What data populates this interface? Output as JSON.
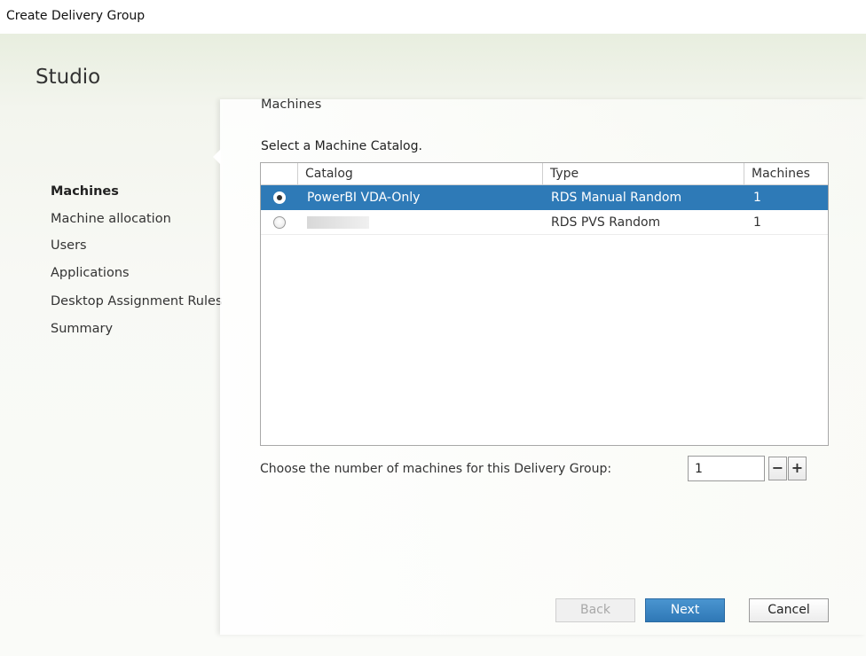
{
  "window": {
    "title": "Create Delivery Group"
  },
  "sidebar": {
    "brand": "Studio",
    "items": [
      {
        "label": "Machines",
        "active": true
      },
      {
        "label": "Machine allocation",
        "active": false
      },
      {
        "label": "Users",
        "active": false
      },
      {
        "label": "Applications",
        "active": false
      },
      {
        "label": "Desktop Assignment Rules",
        "active": false
      },
      {
        "label": "Summary",
        "active": false
      }
    ]
  },
  "main": {
    "title": "Machines",
    "subtitle": "Select a Machine Catalog.",
    "table": {
      "columns": [
        "Catalog",
        "Type",
        "Machines"
      ],
      "rows": [
        {
          "catalog": "PowerBI VDA-Only",
          "type": "RDS Manual Random",
          "machines": "1",
          "selected": true
        },
        {
          "catalog": "",
          "type": "RDS PVS Random",
          "machines": "1",
          "selected": false
        }
      ]
    },
    "count": {
      "label": "Choose the number of machines for this Delivery Group:",
      "value": "1",
      "minus": "−",
      "plus": "+"
    }
  },
  "footer": {
    "back": "Back",
    "next": "Next",
    "cancel": "Cancel"
  },
  "colors": {
    "selection": "#2e7ab7",
    "primary_button": "#3585c3"
  }
}
